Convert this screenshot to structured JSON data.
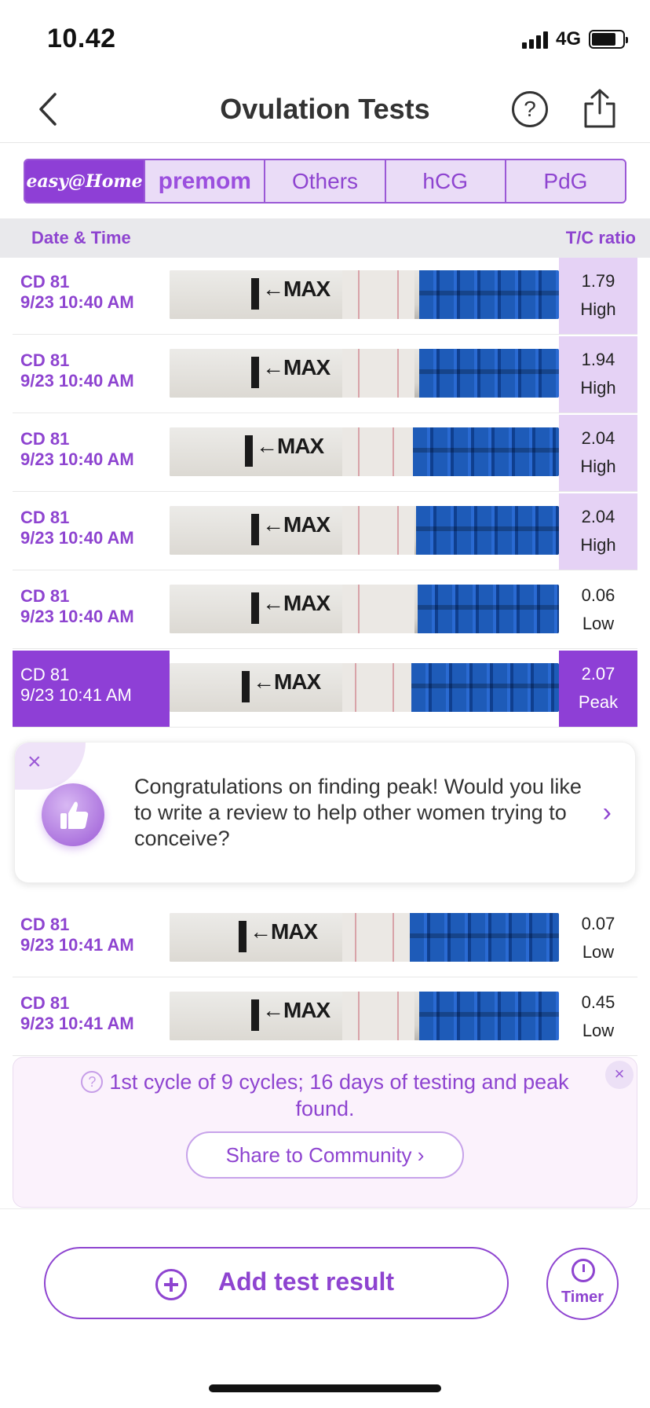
{
  "status_bar": {
    "time": "10.42",
    "network": "4G"
  },
  "nav": {
    "title": "Ovulation Tests",
    "help_symbol": "?"
  },
  "brand_tabs": [
    {
      "label": "easy@Home",
      "active": true
    },
    {
      "label": "premom",
      "active": false
    },
    {
      "label": "Others",
      "active": false
    },
    {
      "label": "hCG",
      "active": false
    },
    {
      "label": "PdG",
      "active": false
    }
  ],
  "table": {
    "col_date": "Date & Time",
    "col_ratio": "T/C ratio",
    "strip_label": "MAX",
    "rows": [
      {
        "cd": "CD 81",
        "datetime": "9/23 10:40 AM",
        "ratio": "1.79",
        "level": "High"
      },
      {
        "cd": "CD 81",
        "datetime": "9/23 10:40 AM",
        "ratio": "1.94",
        "level": "High"
      },
      {
        "cd": "CD 81",
        "datetime": "9/23 10:40 AM",
        "ratio": "2.04",
        "level": "High"
      },
      {
        "cd": "CD 81",
        "datetime": "9/23 10:40 AM",
        "ratio": "2.04",
        "level": "High"
      },
      {
        "cd": "CD 81",
        "datetime": "9/23 10:40 AM",
        "ratio": "0.06",
        "level": "Low"
      },
      {
        "cd": "CD 81",
        "datetime": "9/23 10:41 AM",
        "ratio": "2.07",
        "level": "Peak"
      },
      {
        "cd": "CD 81",
        "datetime": "9/23 10:41 AM",
        "ratio": "0.07",
        "level": "Low"
      },
      {
        "cd": "CD 81",
        "datetime": "9/23 10:41 AM",
        "ratio": "0.45",
        "level": "Low"
      }
    ]
  },
  "review_card": {
    "close": "×",
    "text": "Congratulations on finding peak! Would you like to write a review to help other women trying to conceive?",
    "arrow": "›"
  },
  "summary": {
    "close": "×",
    "help_symbol": "?",
    "text": "1st cycle of 9 cycles; 16 days of testing and peak found.",
    "community_button": "Share to Community ›"
  },
  "actions": {
    "add_label": "Add test result",
    "timer_label": "Timer"
  },
  "colors": {
    "accent": "#8e3fd6",
    "high_bg": "#e5d2f5"
  }
}
